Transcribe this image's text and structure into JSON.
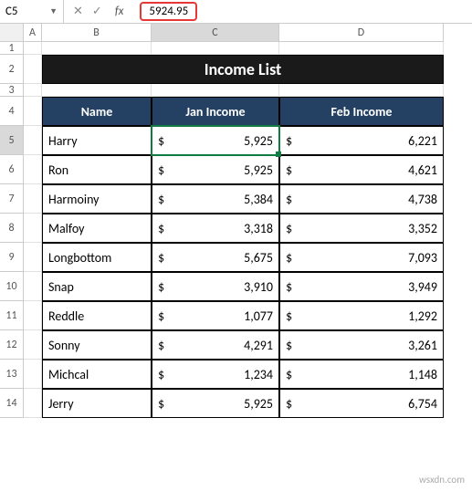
{
  "name_box": "C5",
  "formula_value": "5924.95",
  "columns": [
    "A",
    "B",
    "C",
    "D"
  ],
  "title": "Income List",
  "headers": {
    "name": "Name",
    "jan": "Jan Income",
    "feb": "Feb Income"
  },
  "rows": [
    {
      "name": "Harry",
      "jan": "5,925",
      "feb": "6,221"
    },
    {
      "name": "Ron",
      "jan": "5,925",
      "feb": "4,621"
    },
    {
      "name": "Harmoiny",
      "jan": "5,384",
      "feb": "4,738"
    },
    {
      "name": "Malfoy",
      "jan": "3,318",
      "feb": "3,352"
    },
    {
      "name": "Longbottom",
      "jan": "5,675",
      "feb": "7,093"
    },
    {
      "name": "Snap",
      "jan": "3,910",
      "feb": "3,949"
    },
    {
      "name": "Reddle",
      "jan": "1,077",
      "feb": "1,292"
    },
    {
      "name": "Sonny",
      "jan": "4,291",
      "feb": "3,261"
    },
    {
      "name": "Michcal",
      "jan": "1,234",
      "feb": "1,148"
    },
    {
      "name": "Jerry",
      "jan": "5,925",
      "feb": "6,754"
    }
  ],
  "currency": "$",
  "watermark": "wsxdn.com",
  "chart_data": {
    "type": "table",
    "title": "Income List",
    "columns": [
      "Name",
      "Jan Income",
      "Feb Income"
    ],
    "data": [
      [
        "Harry",
        5925,
        6221
      ],
      [
        "Ron",
        5925,
        4621
      ],
      [
        "Harmoiny",
        5384,
        4738
      ],
      [
        "Malfoy",
        3318,
        3352
      ],
      [
        "Longbottom",
        5675,
        7093
      ],
      [
        "Snap",
        3910,
        3949
      ],
      [
        "Reddle",
        1077,
        1292
      ],
      [
        "Sonny",
        4291,
        3261
      ],
      [
        "Michcal",
        1234,
        1148
      ],
      [
        "Jerry",
        5925,
        6754
      ]
    ]
  }
}
